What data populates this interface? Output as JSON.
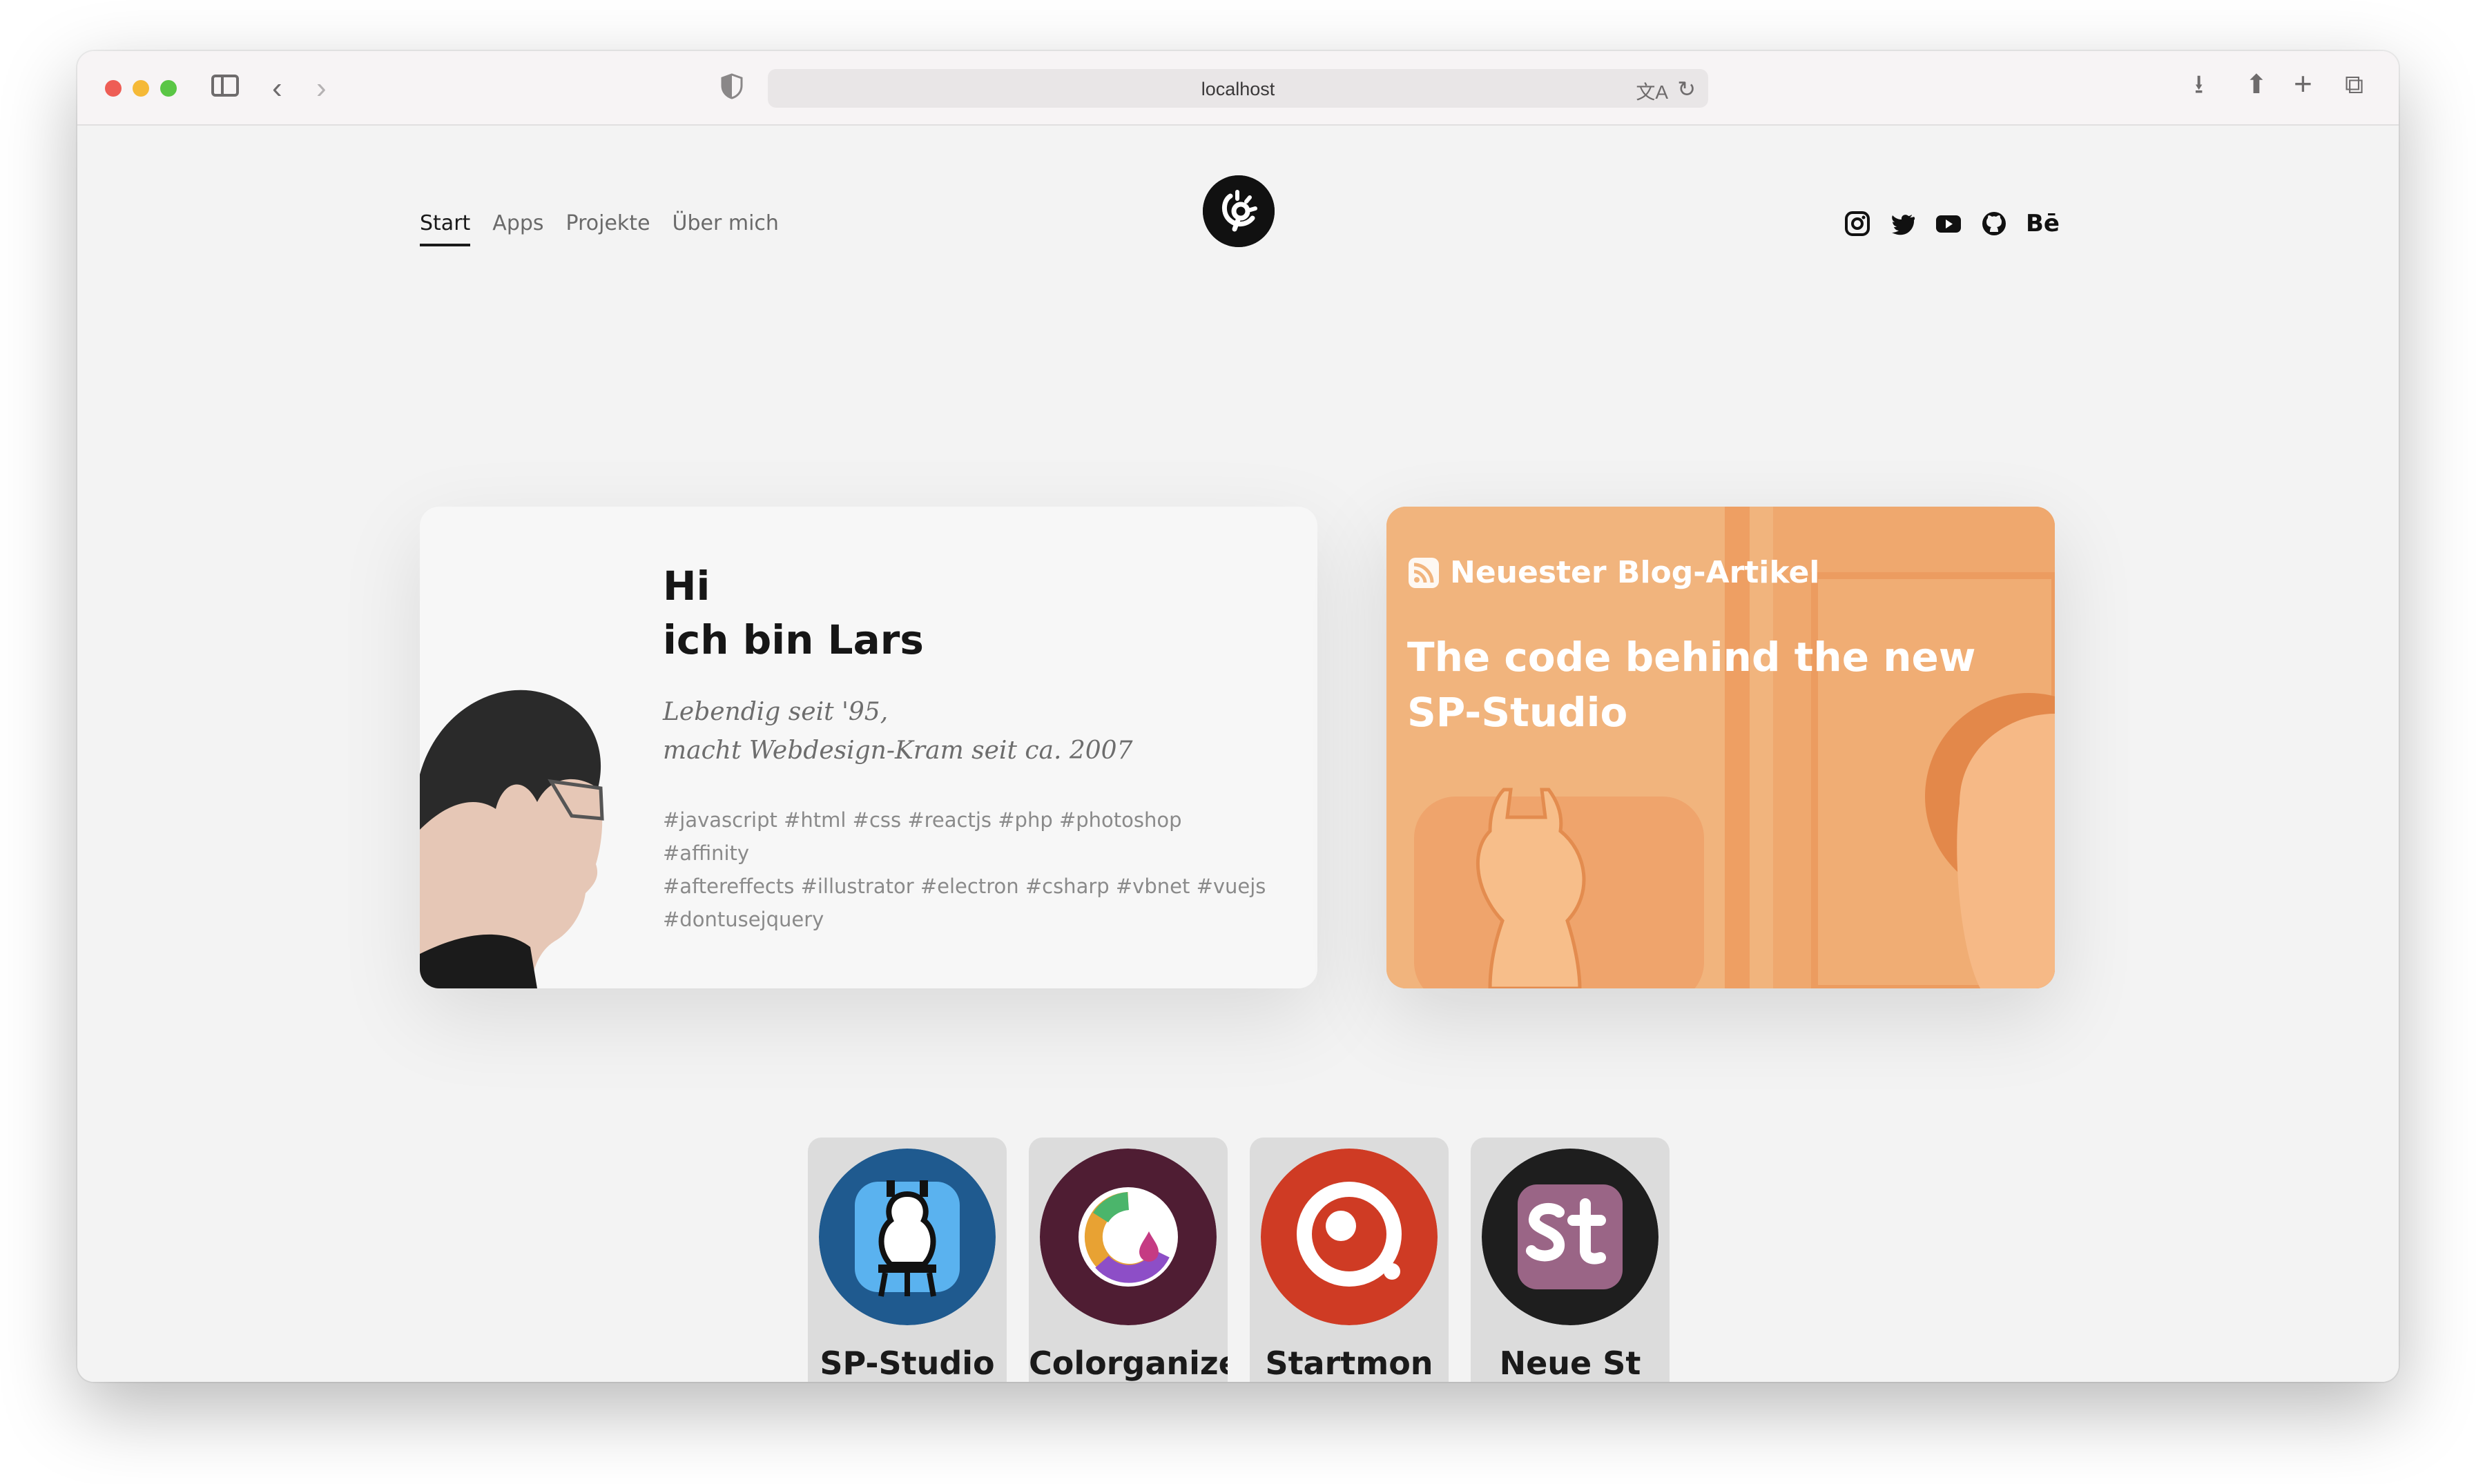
{
  "browser": {
    "url": "localhost"
  },
  "nav": {
    "items": [
      {
        "label": "Start",
        "active": true
      },
      {
        "label": "Apps",
        "active": false
      },
      {
        "label": "Projekte",
        "active": false
      },
      {
        "label": "Über mich",
        "active": false
      }
    ]
  },
  "socials": {
    "behance_label": "Bē"
  },
  "hero": {
    "greeting": "Hi",
    "name_line": "ich bin Lars",
    "script_line1": "Lebendig seit '95,",
    "script_line2": "macht Webdesign-Kram seit ca. 2007",
    "tags_line1": "#javascript #html #css #reactjs #php #photoshop #affinity",
    "tags_line2": "#aftereffects #illustrator #electron #csharp #vbnet #vuejs",
    "tags_line3": "#dontusejquery"
  },
  "blog": {
    "kicker": "Neuester Blog-Artikel",
    "title": "The code behind the new SP-Studio",
    "bg_color": "#f1b47d"
  },
  "apps": [
    {
      "name": "SP-Studio",
      "color": "#1f5a8f"
    },
    {
      "name": "Colorganize",
      "color": "#4f1d33"
    },
    {
      "name": "Startmon",
      "color": "#cf3b24"
    },
    {
      "name": "Neue St",
      "color": "#1e1e1e"
    }
  ]
}
